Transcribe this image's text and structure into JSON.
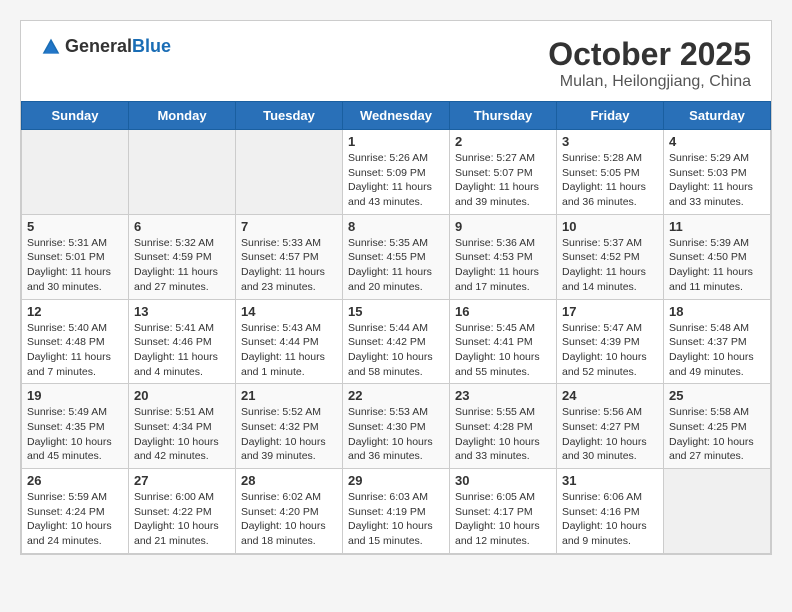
{
  "header": {
    "logo_general": "General",
    "logo_blue": "Blue",
    "month": "October 2025",
    "location": "Mulan, Heilongjiang, China"
  },
  "days_of_week": [
    "Sunday",
    "Monday",
    "Tuesday",
    "Wednesday",
    "Thursday",
    "Friday",
    "Saturday"
  ],
  "weeks": [
    [
      {
        "day": "",
        "info": ""
      },
      {
        "day": "",
        "info": ""
      },
      {
        "day": "",
        "info": ""
      },
      {
        "day": "1",
        "info": "Sunrise: 5:26 AM\nSunset: 5:09 PM\nDaylight: 11 hours and 43 minutes."
      },
      {
        "day": "2",
        "info": "Sunrise: 5:27 AM\nSunset: 5:07 PM\nDaylight: 11 hours and 39 minutes."
      },
      {
        "day": "3",
        "info": "Sunrise: 5:28 AM\nSunset: 5:05 PM\nDaylight: 11 hours and 36 minutes."
      },
      {
        "day": "4",
        "info": "Sunrise: 5:29 AM\nSunset: 5:03 PM\nDaylight: 11 hours and 33 minutes."
      }
    ],
    [
      {
        "day": "5",
        "info": "Sunrise: 5:31 AM\nSunset: 5:01 PM\nDaylight: 11 hours and 30 minutes."
      },
      {
        "day": "6",
        "info": "Sunrise: 5:32 AM\nSunset: 4:59 PM\nDaylight: 11 hours and 27 minutes."
      },
      {
        "day": "7",
        "info": "Sunrise: 5:33 AM\nSunset: 4:57 PM\nDaylight: 11 hours and 23 minutes."
      },
      {
        "day": "8",
        "info": "Sunrise: 5:35 AM\nSunset: 4:55 PM\nDaylight: 11 hours and 20 minutes."
      },
      {
        "day": "9",
        "info": "Sunrise: 5:36 AM\nSunset: 4:53 PM\nDaylight: 11 hours and 17 minutes."
      },
      {
        "day": "10",
        "info": "Sunrise: 5:37 AM\nSunset: 4:52 PM\nDaylight: 11 hours and 14 minutes."
      },
      {
        "day": "11",
        "info": "Sunrise: 5:39 AM\nSunset: 4:50 PM\nDaylight: 11 hours and 11 minutes."
      }
    ],
    [
      {
        "day": "12",
        "info": "Sunrise: 5:40 AM\nSunset: 4:48 PM\nDaylight: 11 hours and 7 minutes."
      },
      {
        "day": "13",
        "info": "Sunrise: 5:41 AM\nSunset: 4:46 PM\nDaylight: 11 hours and 4 minutes."
      },
      {
        "day": "14",
        "info": "Sunrise: 5:43 AM\nSunset: 4:44 PM\nDaylight: 11 hours and 1 minute."
      },
      {
        "day": "15",
        "info": "Sunrise: 5:44 AM\nSunset: 4:42 PM\nDaylight: 10 hours and 58 minutes."
      },
      {
        "day": "16",
        "info": "Sunrise: 5:45 AM\nSunset: 4:41 PM\nDaylight: 10 hours and 55 minutes."
      },
      {
        "day": "17",
        "info": "Sunrise: 5:47 AM\nSunset: 4:39 PM\nDaylight: 10 hours and 52 minutes."
      },
      {
        "day": "18",
        "info": "Sunrise: 5:48 AM\nSunset: 4:37 PM\nDaylight: 10 hours and 49 minutes."
      }
    ],
    [
      {
        "day": "19",
        "info": "Sunrise: 5:49 AM\nSunset: 4:35 PM\nDaylight: 10 hours and 45 minutes."
      },
      {
        "day": "20",
        "info": "Sunrise: 5:51 AM\nSunset: 4:34 PM\nDaylight: 10 hours and 42 minutes."
      },
      {
        "day": "21",
        "info": "Sunrise: 5:52 AM\nSunset: 4:32 PM\nDaylight: 10 hours and 39 minutes."
      },
      {
        "day": "22",
        "info": "Sunrise: 5:53 AM\nSunset: 4:30 PM\nDaylight: 10 hours and 36 minutes."
      },
      {
        "day": "23",
        "info": "Sunrise: 5:55 AM\nSunset: 4:28 PM\nDaylight: 10 hours and 33 minutes."
      },
      {
        "day": "24",
        "info": "Sunrise: 5:56 AM\nSunset: 4:27 PM\nDaylight: 10 hours and 30 minutes."
      },
      {
        "day": "25",
        "info": "Sunrise: 5:58 AM\nSunset: 4:25 PM\nDaylight: 10 hours and 27 minutes."
      }
    ],
    [
      {
        "day": "26",
        "info": "Sunrise: 5:59 AM\nSunset: 4:24 PM\nDaylight: 10 hours and 24 minutes."
      },
      {
        "day": "27",
        "info": "Sunrise: 6:00 AM\nSunset: 4:22 PM\nDaylight: 10 hours and 21 minutes."
      },
      {
        "day": "28",
        "info": "Sunrise: 6:02 AM\nSunset: 4:20 PM\nDaylight: 10 hours and 18 minutes."
      },
      {
        "day": "29",
        "info": "Sunrise: 6:03 AM\nSunset: 4:19 PM\nDaylight: 10 hours and 15 minutes."
      },
      {
        "day": "30",
        "info": "Sunrise: 6:05 AM\nSunset: 4:17 PM\nDaylight: 10 hours and 12 minutes."
      },
      {
        "day": "31",
        "info": "Sunrise: 6:06 AM\nSunset: 4:16 PM\nDaylight: 10 hours and 9 minutes."
      },
      {
        "day": "",
        "info": ""
      }
    ]
  ]
}
